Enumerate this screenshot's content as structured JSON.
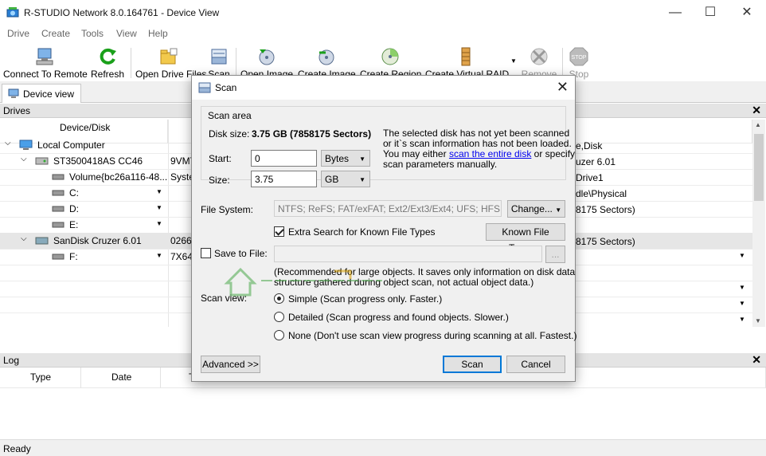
{
  "window": {
    "title": "R-STUDIO Network 8.0.164761 - Device View"
  },
  "menu": [
    "Drive",
    "Create",
    "Tools",
    "View",
    "Help"
  ],
  "toolbar": {
    "connect": "Connect To Remote",
    "refresh": "Refresh",
    "open_files": "Open Drive Files",
    "scan": "Scan",
    "open_image": "Open Image",
    "create_image": "Create Image",
    "create_region": "Create Region",
    "create_raid": "Create Virtual RAID",
    "remove": "Remove",
    "stop": "Stop"
  },
  "tab": {
    "label": "Device view"
  },
  "drives": {
    "title": "Drives",
    "col_device": "Device/Disk",
    "rows": [
      {
        "name": "Local Computer",
        "c2": "",
        "right": "e,Disk"
      },
      {
        "name": "ST3500418AS CC46",
        "c2": "9VMT",
        "right": "uzer 6.01"
      },
      {
        "name": "Volume{bc26a116-48...",
        "c2": "Syste",
        "right": "Drive1"
      },
      {
        "name": "C:",
        "c2": "",
        "right": "dle\\Physical"
      },
      {
        "name": "D:",
        "c2": "",
        "right": "8175 Sectors)"
      },
      {
        "name": "E:",
        "c2": "",
        "right": ""
      },
      {
        "name": "SanDisk Cruzer 6.01",
        "c2": "02668",
        "right": "8175 Sectors)"
      },
      {
        "name": "F:",
        "c2": "7X64",
        "right": ""
      }
    ]
  },
  "log": {
    "title": "Log",
    "cols": [
      "Type",
      "Date",
      "T"
    ]
  },
  "status": {
    "text": "Ready"
  },
  "dialog": {
    "title": "Scan",
    "scan_area": "Scan area",
    "disk_size_label": "Disk size:",
    "disk_size_value": "3.75 GB (7858175 Sectors)",
    "note_1": "The selected disk has not yet been scanned",
    "note_2": "or it`s scan information has not been loaded.",
    "note_3a": "You may either ",
    "note_3_link": "scan the entire disk",
    "note_3b": " or specify",
    "note_4": "scan parameters manually.",
    "start_label": "Start:",
    "start_value": "0",
    "start_unit": "Bytes",
    "size_label": "Size:",
    "size_value": "3.75",
    "size_unit": "GB",
    "fs_label": "File System:",
    "fs_value": "NTFS; ReFS; FAT/exFAT; Ext2/Ext3/Ext4; UFS; HFS",
    "change_btn": "Change...",
    "extra_search": "Extra Search for Known File Types",
    "known_types_btn": "Known File Types...",
    "save_to_file": "Save to File:",
    "browse_btn": "...",
    "rec_1": "(Recommended for large objects. It saves only information on disk data",
    "rec_2": "structure gathered during object scan, not actual object data.)",
    "scan_view_label": "Scan view:",
    "opt_simple": "Simple (Scan progress only. Faster.)",
    "opt_detailed": "Detailed (Scan progress and found objects. Slower.)",
    "opt_none": "None (Don't use scan view progress during scanning at all. Fastest.)",
    "advanced_btn": "Advanced >>",
    "scan_btn": "Scan",
    "cancel_btn": "Cancel"
  },
  "colors": {
    "accent": "#0078d7",
    "link": "#0000ee",
    "green": "#1aa01a"
  }
}
